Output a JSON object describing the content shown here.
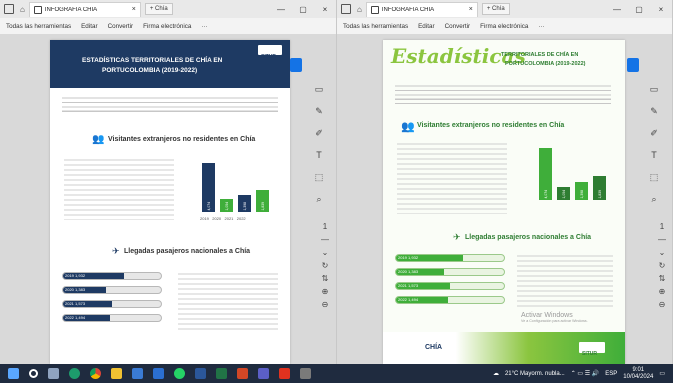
{
  "browser": {
    "tab_title": "INFOGRAFÍA CHÍA",
    "new_tab_label": "+ Chía",
    "tab_close": "×",
    "window_minimize": "—",
    "window_close": "×",
    "toolbar": {
      "all_tools": "Todas las herramientas",
      "edit": "Editar",
      "convert": "Convertir",
      "e_sign": "Firma electrónica",
      "more": "···"
    }
  },
  "infographic": {
    "left_title_line1": "ESTADÍSTICAS TERRITORIALES DE CHÍA EN",
    "left_title_line2": "PORTUCOLOMBIA (2019-2022)",
    "right_title_script": "Estadísticas",
    "right_title_line1": "TERRITORIALES DE CHÍA EN",
    "right_title_line2": "PORTUCOLOMBIA (2019-2022)",
    "brand": "SITUR",
    "section1": "Visitantes extranjeros no residentes en Chía",
    "section2": "Llegadas pasajeros nacionales a Chía",
    "bar_years": [
      "2019",
      "2020",
      "2021",
      "2022"
    ],
    "bar_values": [
      "4,074",
      "1,054",
      "1,398",
      "1,839"
    ],
    "bar_levels": [
      0.82,
      0.21,
      0.28,
      0.37
    ],
    "pill_years": [
      "2019",
      "2020",
      "2021",
      "2022"
    ],
    "pill_values": [
      "1,932",
      "1,383",
      "1,573",
      "1,494"
    ],
    "pill_levels": [
      0.62,
      0.44,
      0.5,
      0.48
    ],
    "chia_logo": "CHÍA",
    "watermark_line1": "Activar Windows",
    "watermark_line2": "Ve a Configuración para activar Windows."
  },
  "taskbar": {
    "weather": "21°C  Mayorm. nubla...",
    "lang": "ESP",
    "time": "9:01",
    "date": "10/04/2024"
  },
  "colors": {
    "navy": "#1e3a63",
    "green": "#3fae3a",
    "green_dark": "#2e7d32",
    "title_green": "#8bc53f"
  }
}
